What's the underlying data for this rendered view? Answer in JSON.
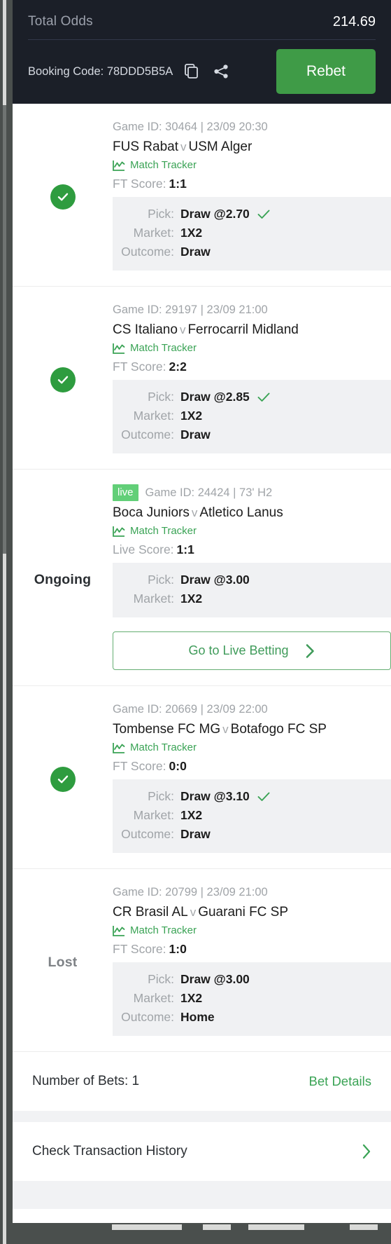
{
  "summary": {
    "total_odds_label": "Total Odds",
    "total_odds_value": "214.69",
    "booking_code_text": "Booking Code: 78DDD5B5A",
    "copy_icon": "copy-icon",
    "share_icon": "share-icon",
    "rebet_label": "Rebet",
    "accent_green": "#3f9b47",
    "header_bg": "#1b1f28"
  },
  "labels": {
    "tracker": "Match Tracker",
    "pick": "Pick:",
    "market": "Market:",
    "outcome": "Outcome:",
    "ft_score": "FT Score:",
    "live_score": "Live Score:",
    "live_badge": "live",
    "vs": "v"
  },
  "bets": [
    {
      "status": "won",
      "status_label": "",
      "is_live": false,
      "game_meta": "Game ID: 30464 | 23/09 20:30",
      "home": "FUS Rabat",
      "away": "USM Alger",
      "score_label": "FT Score:",
      "score": "1:1",
      "pick": "Draw @2.70",
      "pick_won": true,
      "market": "1X2",
      "outcome": "Draw",
      "show_outcome": true,
      "live_button": false
    },
    {
      "status": "won",
      "status_label": "",
      "is_live": false,
      "game_meta": "Game ID: 29197 | 23/09 21:00",
      "home": "CS Italiano",
      "away": "Ferrocarril Midland",
      "score_label": "FT Score:",
      "score": "2:2",
      "pick": "Draw @2.85",
      "pick_won": true,
      "market": "1X2",
      "outcome": "Draw",
      "show_outcome": true,
      "live_button": false
    },
    {
      "status": "ongoing",
      "status_label": "Ongoing",
      "is_live": true,
      "game_meta": "Game ID: 24424 | 73' H2",
      "home": "Boca Juniors",
      "away": "Atletico Lanus",
      "score_label": "Live Score:",
      "score": "1:1",
      "pick": "Draw @3.00",
      "pick_won": false,
      "market": "1X2",
      "outcome": "",
      "show_outcome": false,
      "live_button": true,
      "live_button_label": "Go to Live Betting"
    },
    {
      "status": "won",
      "status_label": "",
      "is_live": false,
      "game_meta": "Game ID: 20669 | 23/09 22:00",
      "home": "Tombense FC MG",
      "away": "Botafogo FC SP",
      "score_label": "FT Score:",
      "score": "0:0",
      "pick": "Draw @3.10",
      "pick_won": true,
      "market": "1X2",
      "outcome": "Draw",
      "show_outcome": true,
      "live_button": false
    },
    {
      "status": "lost",
      "status_label": "Lost",
      "is_live": false,
      "game_meta": "Game ID: 20799 | 23/09 21:00",
      "home": "CR Brasil AL",
      "away": "Guarani FC SP",
      "score_label": "FT Score:",
      "score": "1:0",
      "pick": "Draw @3.00",
      "pick_won": false,
      "market": "1X2",
      "outcome": "Home",
      "show_outcome": true,
      "live_button": false
    }
  ],
  "footer": {
    "number_of_bets": "Number of Bets: 1",
    "bet_details_label": "Bet Details",
    "transaction_history_label": "Check Transaction History",
    "chevron_icon": "chevron-right-icon"
  }
}
